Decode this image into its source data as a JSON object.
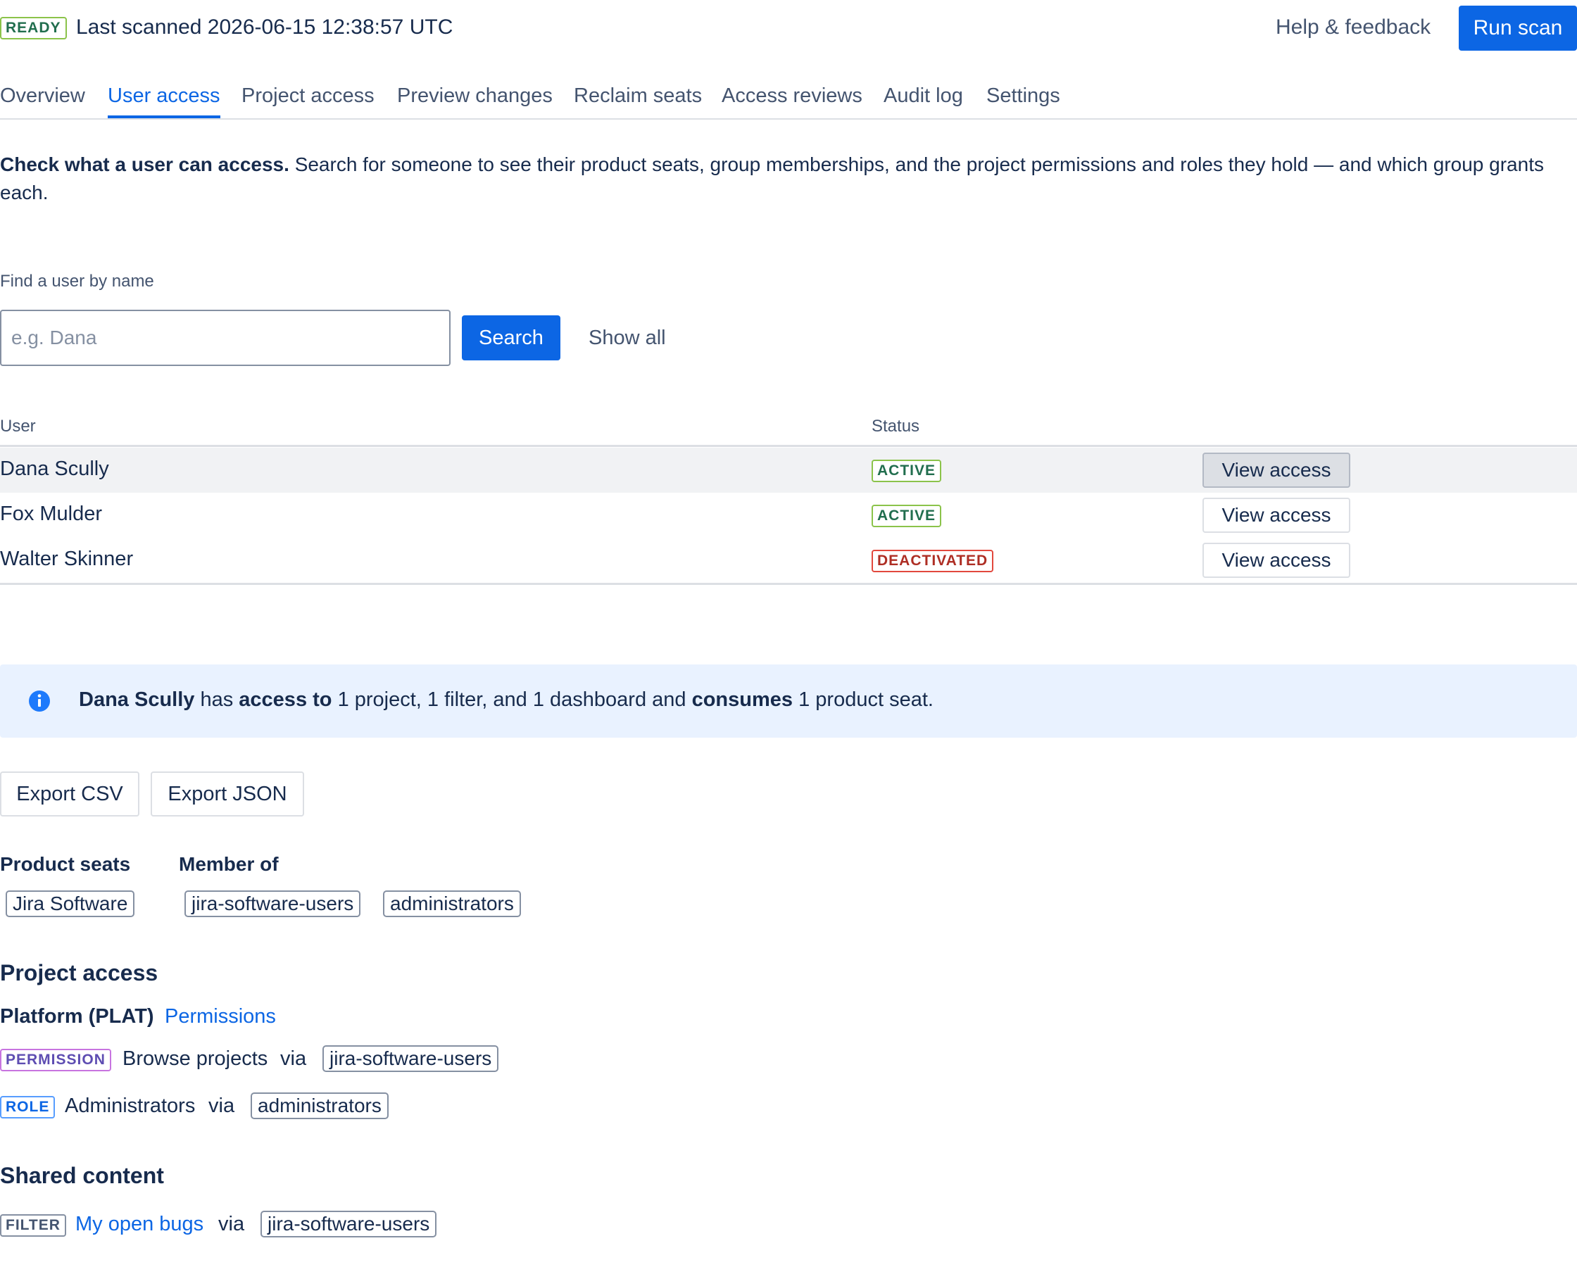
{
  "header": {
    "status_badge": "READY",
    "last_scanned": "Last scanned 2026-06-15 12:38:57 UTC",
    "help_link": "Help & feedback",
    "run_scan": "Run scan"
  },
  "tabs": [
    {
      "label": "Overview"
    },
    {
      "label": "User access"
    },
    {
      "label": "Project access"
    },
    {
      "label": "Preview changes"
    },
    {
      "label": "Reclaim seats"
    },
    {
      "label": "Access reviews"
    },
    {
      "label": "Audit log"
    },
    {
      "label": "Settings"
    }
  ],
  "active_tab": "User access",
  "intro": {
    "bold": "Check what a user can access.",
    "text": "Search for someone to see their product seats, group memberships, and the project permissions and roles they hold — and which group grants each."
  },
  "search": {
    "label": "Find a user by name",
    "placeholder": "e.g. Dana",
    "value": "",
    "button": "Search",
    "show_all": "Show all"
  },
  "users_table": {
    "columns": [
      "User",
      "Status"
    ],
    "action_label": "View access",
    "rows": [
      {
        "name": "Dana Scully",
        "status": "ACTIVE",
        "selected": true
      },
      {
        "name": "Fox Mulder",
        "status": "ACTIVE",
        "selected": false
      },
      {
        "name": "Walter Skinner",
        "status": "DEACTIVATED",
        "selected": false
      }
    ]
  },
  "summary": {
    "user": "Dana Scully",
    "has": "has",
    "access_to": "access to",
    "resources": "1 project, 1 filter, and 1 dashboard and",
    "consumes": "consumes",
    "seats": "1 product seat."
  },
  "export": {
    "csv": "Export CSV",
    "json": "Export JSON"
  },
  "product_seats": {
    "heading": "Product seats",
    "items": [
      "Jira Software"
    ]
  },
  "member_of": {
    "heading": "Member of",
    "items": [
      "jira-software-users",
      "administrators"
    ]
  },
  "project_access": {
    "heading": "Project access",
    "project": "Platform (PLAT)",
    "permissions_link": "Permissions",
    "grants": [
      {
        "type": "PERMISSION",
        "name": "Browse projects",
        "via": "via",
        "group": "jira-software-users"
      },
      {
        "type": "ROLE",
        "name": "Administrators",
        "via": "via",
        "group": "administrators"
      }
    ]
  },
  "shared_content": {
    "heading": "Shared content",
    "items": [
      {
        "type": "FILTER",
        "name": "My open bugs",
        "via": "via",
        "group": "jira-software-users"
      }
    ]
  },
  "colors": {
    "primary": "#0c66e4",
    "text": "#172b4d",
    "subtle": "#44546f",
    "info_bg": "#e9f2ff",
    "active_border": "#8bc34a",
    "deactivated_border": "#e2483d"
  }
}
